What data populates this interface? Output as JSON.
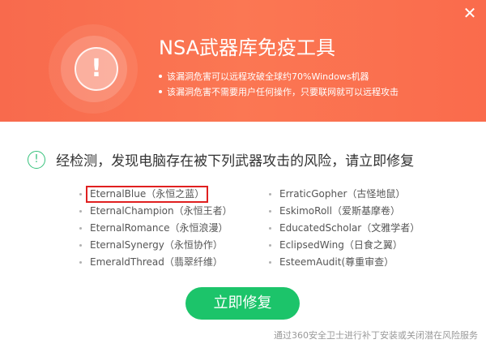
{
  "header": {
    "title": "NSA武器库免疫工具",
    "bullets": [
      "该漏洞危害可以远程攻破全球约70%Windows机器",
      "该漏洞危害不需要用户任何操作，只要联网就可以远程攻击"
    ],
    "alert_symbol": "!",
    "background_color": "#fb7753"
  },
  "close_symbol": "✕",
  "result": {
    "icon_symbol": "!",
    "message": "经检测，发现电脑存在被下列武器攻击的风险，请立即修复"
  },
  "weapons_left": [
    "EternalBlue（永恒之蓝）",
    "EternalChampion（永恒王者）",
    "EternalRomance（永恒浪漫）",
    "EternalSynergy（永恒协作）",
    "EmeraldThread（翡翠纤维）"
  ],
  "weapons_right": [
    "ErraticGopher（古怪地鼠）",
    "EskimoRoll（爱斯基摩卷）",
    "EducatedScholar（文雅学者）",
    "EclipsedWing（日食之翼）",
    "EsteemAudit(尊重审查）"
  ],
  "fix_button_label": "立即修复",
  "footer_note": "通过360安全卫士进行补丁安装或关闭潜在风险服务",
  "colors": {
    "accent_green": "#1cc46a",
    "highlight_red": "#e02020"
  }
}
